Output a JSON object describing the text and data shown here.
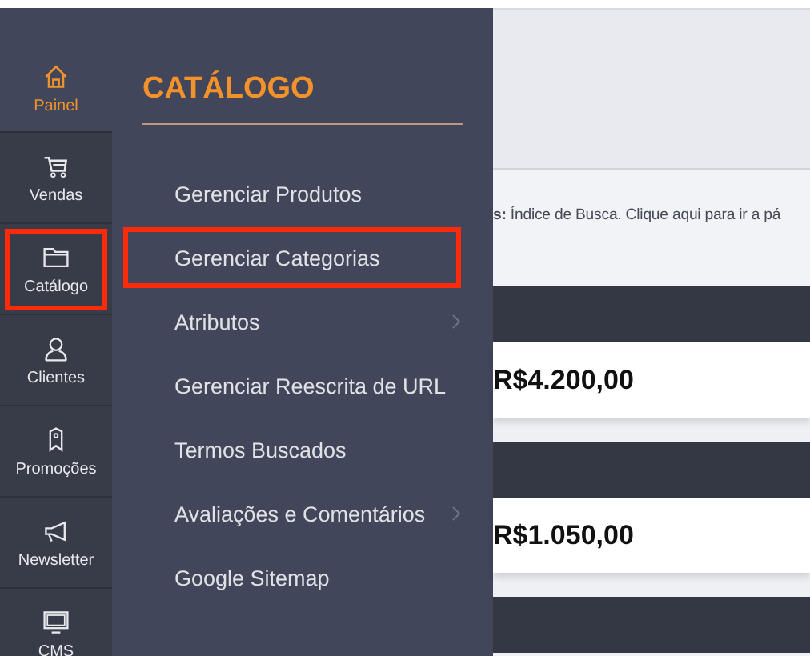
{
  "nav": [
    {
      "label": "Painel",
      "kind": "home",
      "selected": true,
      "highlighted": false
    },
    {
      "label": "Vendas",
      "kind": "cart",
      "selected": false,
      "highlighted": false
    },
    {
      "label": "Catálogo",
      "kind": "folder",
      "selected": false,
      "highlighted": true
    },
    {
      "label": "Clientes",
      "kind": "user",
      "selected": false,
      "highlighted": false
    },
    {
      "label": "Promoções",
      "kind": "tag",
      "selected": false,
      "highlighted": false
    },
    {
      "label": "Newsletter",
      "kind": "megaphone",
      "selected": false,
      "highlighted": false
    },
    {
      "label": "CMS",
      "kind": "monitor",
      "selected": false,
      "highlighted": false
    }
  ],
  "flyout": {
    "title": "CATÁLOGO",
    "items": [
      {
        "label": "Gerenciar Produtos",
        "has_submenu": false,
        "highlighted": false
      },
      {
        "label": "Gerenciar Categorias",
        "has_submenu": false,
        "highlighted": true
      },
      {
        "label": "Atributos",
        "has_submenu": true,
        "highlighted": false
      },
      {
        "label": "Gerenciar Reescrita de URL",
        "has_submenu": false,
        "highlighted": false
      },
      {
        "label": "Termos Buscados",
        "has_submenu": false,
        "highlighted": false
      },
      {
        "label": "Avaliações e Comentários",
        "has_submenu": true,
        "highlighted": false
      },
      {
        "label": "Google Sitemap",
        "has_submenu": false,
        "highlighted": false
      }
    ]
  },
  "main": {
    "message": "**s:** Índice de Busca. Clique aqui para ir a pá",
    "cards": [
      {
        "value": "R$4.200,00"
      },
      {
        "value": "R$1.050,00"
      }
    ]
  }
}
